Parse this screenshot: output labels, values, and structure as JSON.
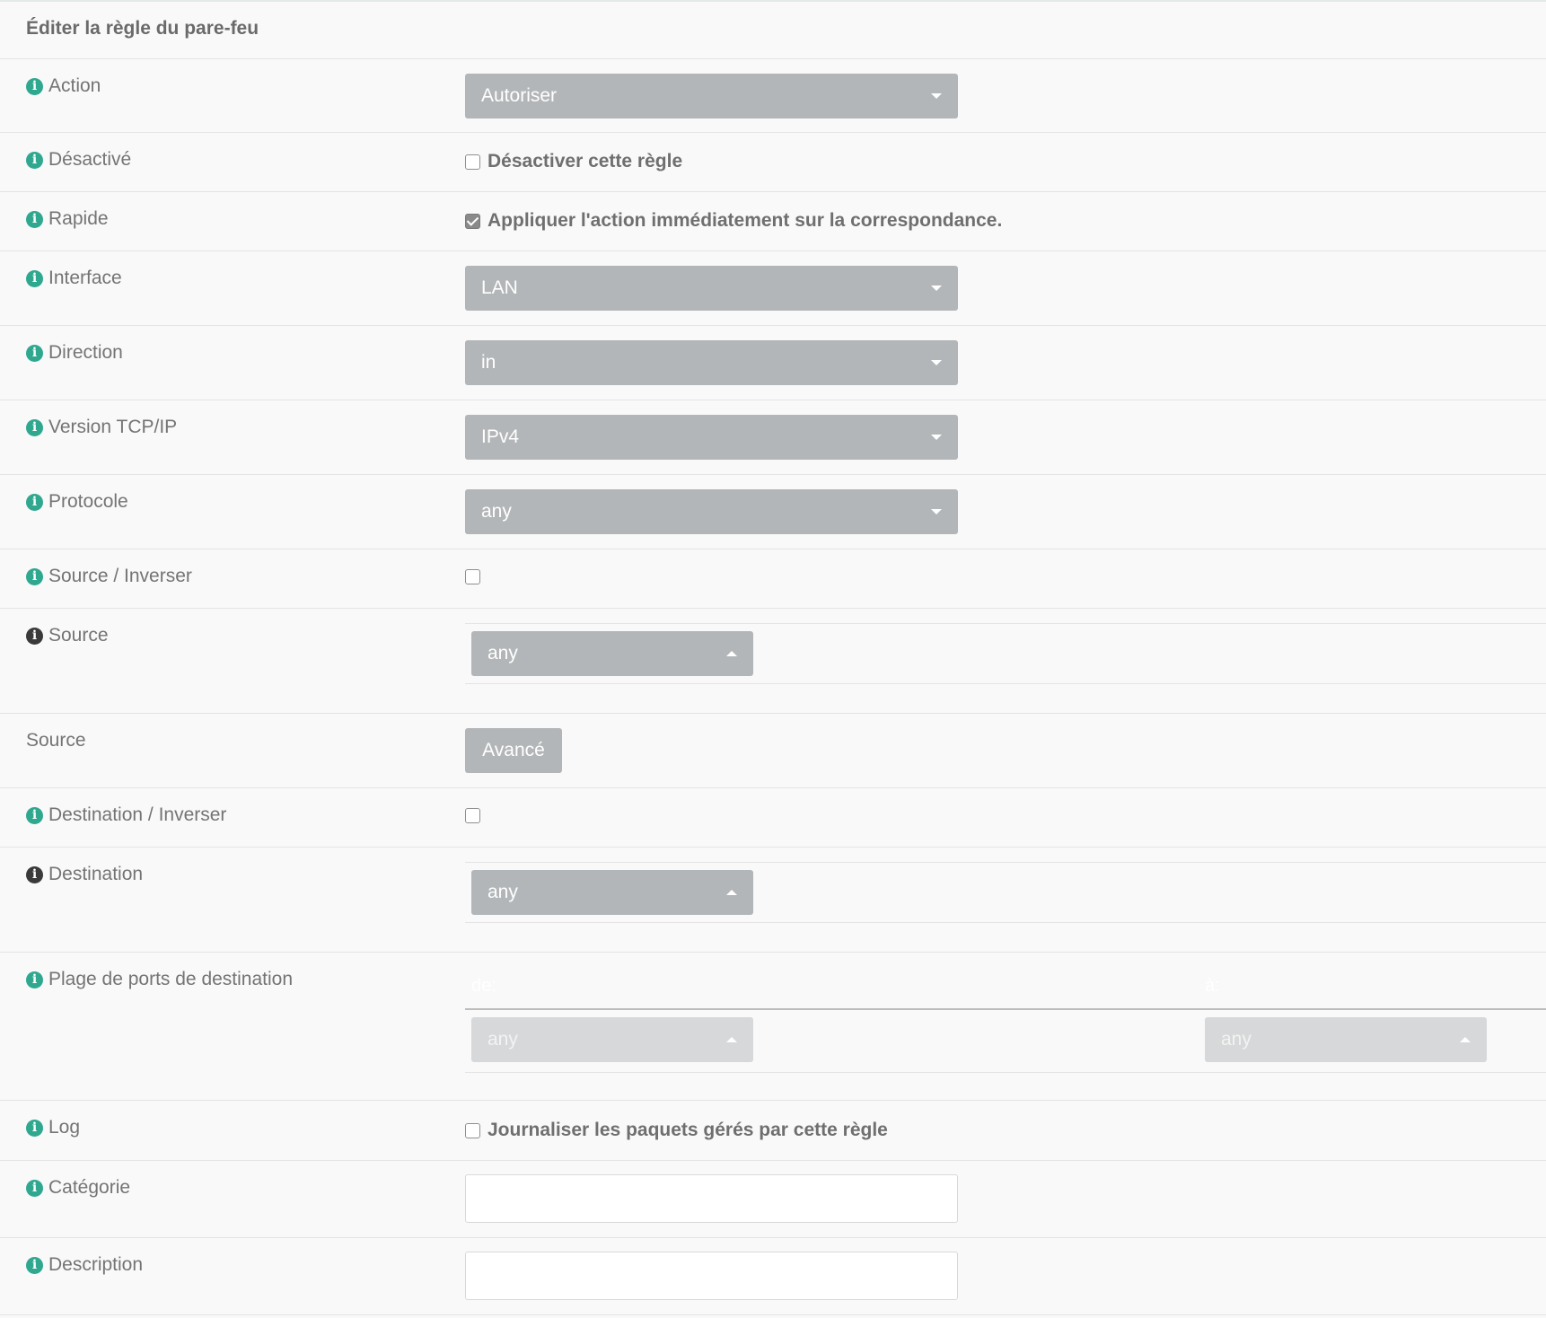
{
  "header": {
    "title": "Éditer la règle du pare-feu"
  },
  "rows": {
    "action": {
      "label": "Action",
      "value": "Autoriser"
    },
    "disabled": {
      "label": "Désactivé",
      "checkbox_label": "Désactiver cette règle",
      "checked": false
    },
    "quick": {
      "label": "Rapide",
      "checkbox_label": "Appliquer l'action immédiatement sur la correspondance.",
      "checked": true
    },
    "interface": {
      "label": "Interface",
      "value": "LAN"
    },
    "direction": {
      "label": "Direction",
      "value": "in"
    },
    "ip_version": {
      "label": "Version TCP/IP",
      "value": "IPv4"
    },
    "protocol": {
      "label": "Protocole",
      "value": "any"
    },
    "source_invert": {
      "label": "Source / Inverser",
      "checked": false
    },
    "source": {
      "label": "Source",
      "value": "any"
    },
    "source_advanced": {
      "label": "Source",
      "button_label": "Avancé"
    },
    "destination_invert": {
      "label": "Destination / Inverser",
      "checked": false
    },
    "destination": {
      "label": "Destination",
      "value": "any"
    },
    "dest_port_range": {
      "label": "Plage de ports de destination",
      "from_label": "de:",
      "to_label": "à:",
      "from_value": "any",
      "to_value": "any"
    },
    "log": {
      "label": "Log",
      "checkbox_label": "Journaliser les paquets gérés par cette règle",
      "checked": false
    },
    "category": {
      "label": "Catégorie",
      "value": ""
    },
    "description": {
      "label": "Description",
      "value": ""
    }
  }
}
